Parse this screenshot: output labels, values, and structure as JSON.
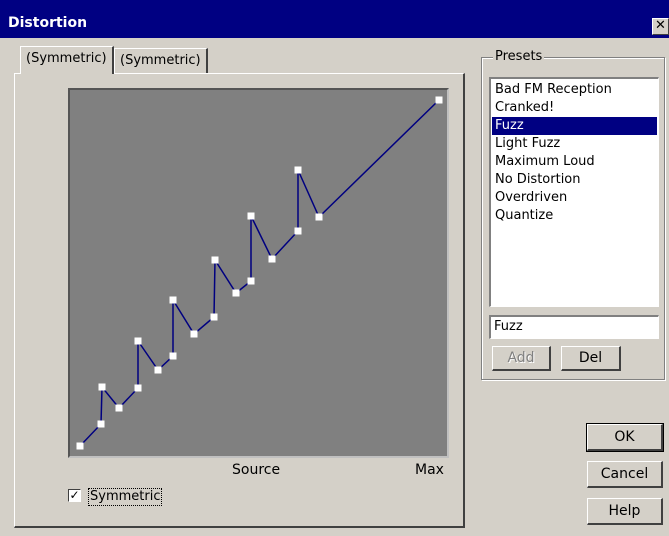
{
  "window": {
    "title": "Distortion",
    "close_glyph": "✕"
  },
  "tabs": [
    {
      "label": "(Symmetric)"
    },
    {
      "label": "(Symmetric)"
    }
  ],
  "graph": {
    "x_label": "Source",
    "x_max_label": "Max",
    "line_color": "#000080",
    "background_color": "#808080",
    "point_color": "#ffffff"
  },
  "symmetric_checkbox": {
    "label": "Symmetric",
    "checked": true,
    "check_glyph": "✓"
  },
  "presets": {
    "group_label": "Presets",
    "items": [
      "Bad FM Reception",
      "Cranked!",
      "Fuzz",
      "Light Fuzz",
      "Maximum Loud",
      "No Distortion",
      "Overdriven",
      "Quantize"
    ],
    "selected": "Fuzz",
    "name_value": "Fuzz",
    "add_label": "Add",
    "del_label": "Del"
  },
  "buttons": {
    "ok": "OK",
    "cancel": "Cancel",
    "help": "Help"
  }
}
